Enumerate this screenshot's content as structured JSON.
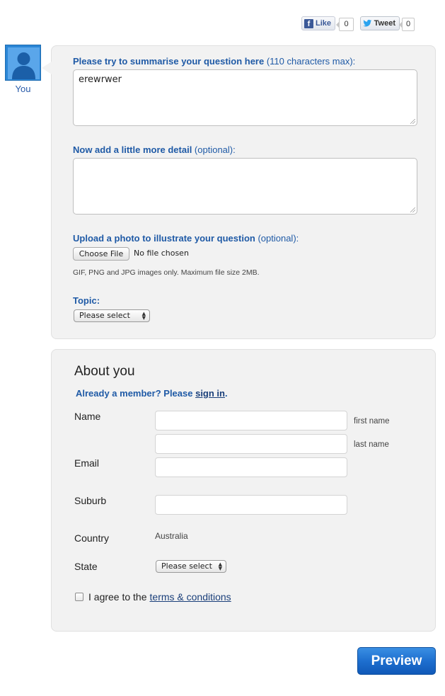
{
  "social": {
    "like_label": "Like",
    "like_count": "0",
    "tweet_label": "Tweet",
    "tweet_count": "0"
  },
  "user": {
    "label": "You"
  },
  "question": {
    "summary_label_bold": "Please try to summarise your question here",
    "summary_label_note": " (110 characters max):",
    "summary_value": "erewrwer",
    "detail_label_bold": "Now add a little more detail",
    "detail_label_note": " (optional):",
    "detail_value": "",
    "upload_label_bold": "Upload a photo to illustrate your question",
    "upload_label_note": " (optional):",
    "choose_file_label": "Choose File",
    "file_status": "No file chosen",
    "file_hint": "GIF, PNG and JPG images only. Maximum file size 2MB.",
    "topic_label": "Topic:",
    "topic_selected": "Please select"
  },
  "about": {
    "title": "About you",
    "member_prompt": "Already a member? Please ",
    "sign_in_link": "sign in",
    "member_end": ".",
    "name_label": "Name",
    "first_name_hint": "first name",
    "last_name_hint": "last name",
    "email_label": "Email",
    "suburb_label": "Suburb",
    "country_label": "Country",
    "country_value": "Australia",
    "state_label": "State",
    "state_selected": "Please select",
    "agree_text": "I agree to the",
    "terms_link": "terms & conditions"
  },
  "actions": {
    "preview_label": "Preview"
  },
  "colors": {
    "accent": "#1f5aa6",
    "panel": "#f2f2f2",
    "button": "#1e6fcf"
  }
}
